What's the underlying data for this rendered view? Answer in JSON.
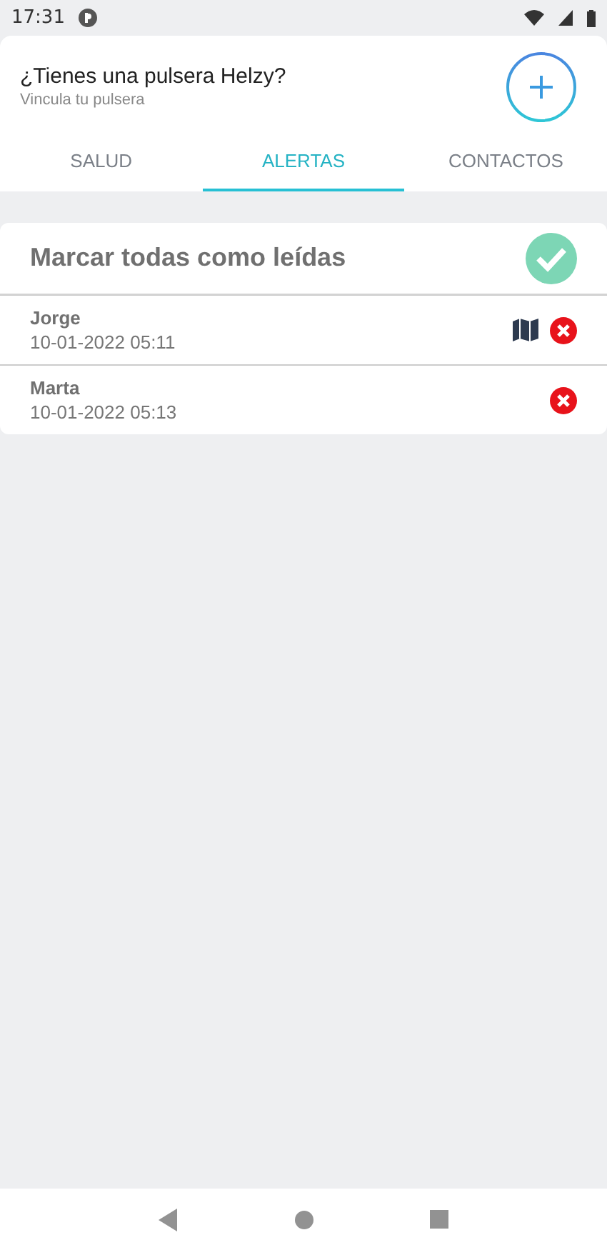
{
  "status_bar": {
    "time": "17:31"
  },
  "header": {
    "title": "¿Tienes una pulsera Helzy?",
    "subtitle": "Vincula tu pulsera"
  },
  "tabs": [
    {
      "label": "SALUD",
      "selected": false
    },
    {
      "label": "ALERTAS",
      "selected": true
    },
    {
      "label": "CONTACTOS",
      "selected": false
    }
  ],
  "mark_all": {
    "label": "Marcar todas como leídas"
  },
  "alerts": [
    {
      "name": "Jorge",
      "date": "10-01-2022 05:11",
      "has_map": true
    },
    {
      "name": "Marta",
      "date": "10-01-2022 05:13",
      "has_map": false
    }
  ]
}
